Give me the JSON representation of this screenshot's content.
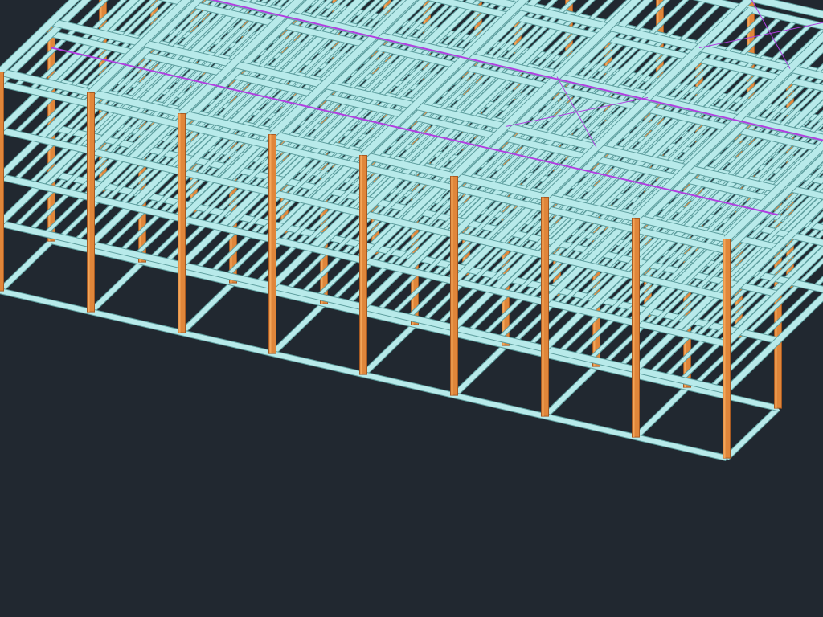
{
  "viewport": {
    "background": "#212830",
    "model": "3d-steel-frame-building",
    "view": "isometric"
  },
  "structure": {
    "column_color": "#e0863a",
    "column_shade": "#a85a22",
    "column_highlight": "#f2a65a",
    "beam_color": "#b8eaea",
    "beam_shade": "#7fc4c4",
    "beam_edge": "#5e9e9e",
    "bracing_color": "#b040e0",
    "levels": 4,
    "bays_along": 8,
    "bays_across": 4,
    "joists_per_bay": 5
  }
}
